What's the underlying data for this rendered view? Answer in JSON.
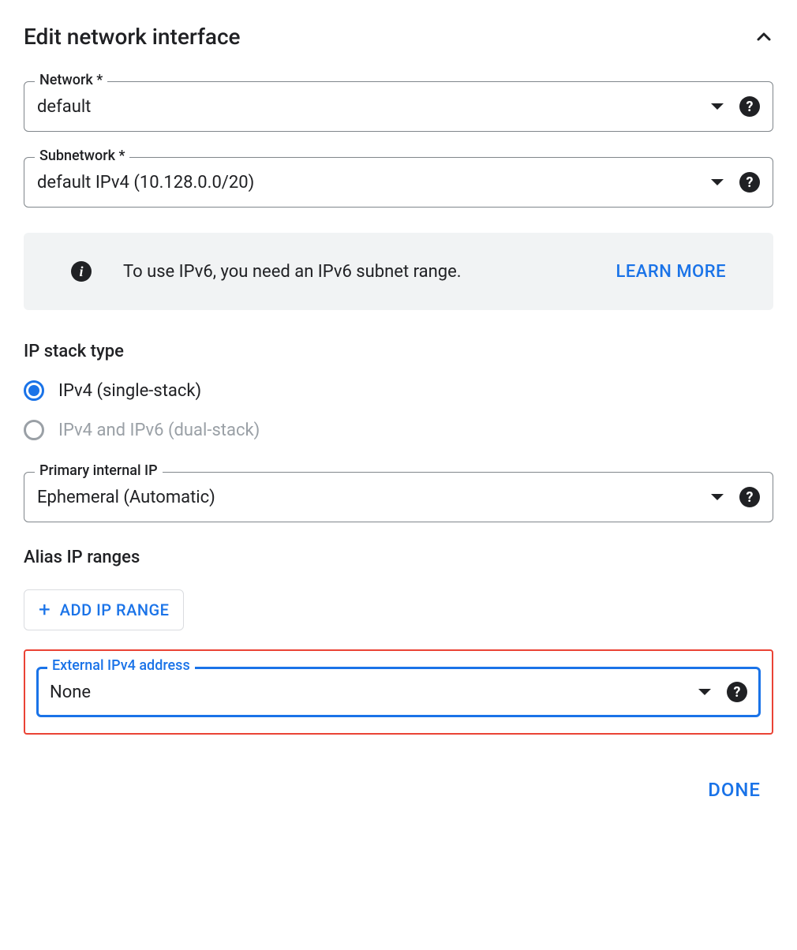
{
  "header": {
    "title": "Edit network interface"
  },
  "network": {
    "label": "Network *",
    "value": "default"
  },
  "subnetwork": {
    "label": "Subnetwork *",
    "value": "default IPv4 (10.128.0.0/20)"
  },
  "ipv6_info": {
    "text": "To use IPv6, you need an IPv6 subnet range.",
    "learn_more": "LEARN MORE"
  },
  "ip_stack": {
    "label": "IP stack type",
    "options": [
      {
        "label": "IPv4 (single-stack)",
        "selected": true,
        "disabled": false
      },
      {
        "label": "IPv4 and IPv6 (dual-stack)",
        "selected": false,
        "disabled": true
      }
    ]
  },
  "primary_internal_ip": {
    "label": "Primary internal IP",
    "value": "Ephemeral (Automatic)"
  },
  "alias": {
    "label": "Alias IP ranges",
    "add_button": "ADD IP RANGE"
  },
  "external_ipv4": {
    "label": "External IPv4 address",
    "value": "None"
  },
  "done_button": "DONE"
}
